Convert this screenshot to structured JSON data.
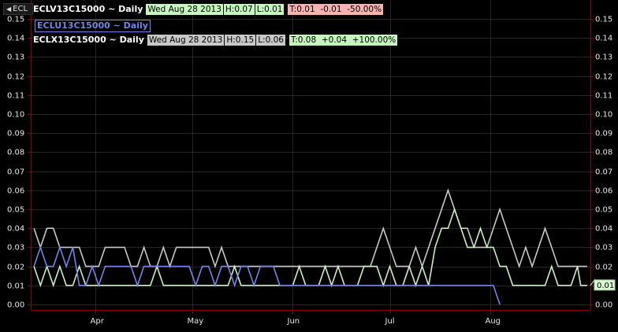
{
  "collapse_label": "ECL",
  "legend": [
    {
      "name": "ECLV13C15000 ~ Daily",
      "date": "Wed Aug 28 2013",
      "high": "H:0.07",
      "low": "L:0.01",
      "last": "T:0.01",
      "change": "-0.01",
      "pct": "-50.00%"
    },
    {
      "name": "ECLU13C15000 ~ Daily"
    },
    {
      "name": "ECLX13C15000 ~ Daily",
      "date": "Wed Aug 28 2013",
      "high": "H:0.15",
      "low": "L:0.06",
      "last": "T:0.08",
      "change": "+0.04",
      "pct": "+100.00%"
    }
  ],
  "colors": {
    "background": "#000000",
    "gridline": "#262626",
    "axis": "#8b0000",
    "series_white": "#c8c8c8",
    "series_green": "#c8f0c0",
    "series_blue": "#6f86e8",
    "tag_green": "#c6f5c0",
    "tag_red": "#f7b2b2",
    "tag_gray": "#c8c8c8"
  },
  "chart_data": {
    "type": "line",
    "ylim": [
      0,
      0.15
    ],
    "yticks": [
      "0.00",
      "0.01",
      "0.02",
      "0.03",
      "0.04",
      "0.05",
      "0.06",
      "0.07",
      "0.08",
      "0.09",
      "0.10",
      "0.11",
      "0.12",
      "0.13",
      "0.14",
      "0.15"
    ],
    "xlim": [
      "2013-03-12",
      "2013-09-01"
    ],
    "months": [
      {
        "label": "Apr",
        "date": "2013-04-01"
      },
      {
        "label": "May",
        "date": "2013-05-01"
      },
      {
        "label": "Jun",
        "date": "2013-06-01"
      },
      {
        "label": "Jul",
        "date": "2013-07-01"
      },
      {
        "label": "Aug",
        "date": "2013-08-01"
      }
    ],
    "last_value_label": "0.01",
    "series": [
      {
        "name": "ECLX13C15000 ~ Daily",
        "color": "#c8c8c8",
        "points": [
          [
            "2013-03-13",
            0.04
          ],
          [
            "2013-03-15",
            0.03
          ],
          [
            "2013-03-17",
            0.04
          ],
          [
            "2013-03-19",
            0.04
          ],
          [
            "2013-03-21",
            0.03
          ],
          [
            "2013-03-23",
            0.03
          ],
          [
            "2013-03-25",
            0.03
          ],
          [
            "2013-03-27",
            0.03
          ],
          [
            "2013-03-29",
            0.02
          ],
          [
            "2013-03-31",
            0.02
          ],
          [
            "2013-04-02",
            0.02
          ],
          [
            "2013-04-04",
            0.03
          ],
          [
            "2013-04-06",
            0.03
          ],
          [
            "2013-04-08",
            0.03
          ],
          [
            "2013-04-10",
            0.03
          ],
          [
            "2013-04-12",
            0.02
          ],
          [
            "2013-04-14",
            0.02
          ],
          [
            "2013-04-16",
            0.03
          ],
          [
            "2013-04-18",
            0.02
          ],
          [
            "2013-04-20",
            0.02
          ],
          [
            "2013-04-22",
            0.03
          ],
          [
            "2013-04-24",
            0.02
          ],
          [
            "2013-04-26",
            0.03
          ],
          [
            "2013-04-28",
            0.03
          ],
          [
            "2013-04-30",
            0.03
          ],
          [
            "2013-05-02",
            0.03
          ],
          [
            "2013-05-04",
            0.03
          ],
          [
            "2013-05-06",
            0.03
          ],
          [
            "2013-05-08",
            0.02
          ],
          [
            "2013-05-10",
            0.03
          ],
          [
            "2013-05-12",
            0.02
          ],
          [
            "2013-05-14",
            0.02
          ],
          [
            "2013-05-16",
            0.02
          ],
          [
            "2013-05-18",
            0.02
          ],
          [
            "2013-05-20",
            0.02
          ],
          [
            "2013-05-22",
            0.02
          ],
          [
            "2013-05-24",
            0.02
          ],
          [
            "2013-05-26",
            0.02
          ],
          [
            "2013-05-28",
            0.02
          ],
          [
            "2013-05-30",
            0.02
          ],
          [
            "2013-06-01",
            0.02
          ],
          [
            "2013-06-03",
            0.02
          ],
          [
            "2013-06-05",
            0.02
          ],
          [
            "2013-06-07",
            0.02
          ],
          [
            "2013-06-09",
            0.02
          ],
          [
            "2013-06-11",
            0.02
          ],
          [
            "2013-06-13",
            0.02
          ],
          [
            "2013-06-15",
            0.02
          ],
          [
            "2013-06-17",
            0.02
          ],
          [
            "2013-06-19",
            0.02
          ],
          [
            "2013-06-21",
            0.02
          ],
          [
            "2013-06-23",
            0.02
          ],
          [
            "2013-06-25",
            0.02
          ],
          [
            "2013-06-27",
            0.03
          ],
          [
            "2013-06-29",
            0.04
          ],
          [
            "2013-07-01",
            0.03
          ],
          [
            "2013-07-03",
            0.02
          ],
          [
            "2013-07-05",
            0.02
          ],
          [
            "2013-07-07",
            0.02
          ],
          [
            "2013-07-09",
            0.03
          ],
          [
            "2013-07-11",
            0.02
          ],
          [
            "2013-07-13",
            0.03
          ],
          [
            "2013-07-15",
            0.04
          ],
          [
            "2013-07-17",
            0.05
          ],
          [
            "2013-07-19",
            0.06
          ],
          [
            "2013-07-21",
            0.05
          ],
          [
            "2013-07-23",
            0.04
          ],
          [
            "2013-07-25",
            0.04
          ],
          [
            "2013-07-27",
            0.03
          ],
          [
            "2013-07-29",
            0.03
          ],
          [
            "2013-07-31",
            0.03
          ],
          [
            "2013-08-02",
            0.04
          ],
          [
            "2013-08-04",
            0.05
          ],
          [
            "2013-08-06",
            0.04
          ],
          [
            "2013-08-08",
            0.03
          ],
          [
            "2013-08-10",
            0.02
          ],
          [
            "2013-08-12",
            0.03
          ],
          [
            "2013-08-14",
            0.02
          ],
          [
            "2013-08-16",
            0.03
          ],
          [
            "2013-08-18",
            0.04
          ],
          [
            "2013-08-20",
            0.03
          ],
          [
            "2013-08-22",
            0.02
          ],
          [
            "2013-08-24",
            0.02
          ],
          [
            "2013-08-26",
            0.02
          ],
          [
            "2013-08-28",
            0.02
          ],
          [
            "2013-08-29",
            0.02
          ],
          [
            "2013-08-30",
            0.02
          ],
          [
            "2013-08-31",
            0.02
          ]
        ]
      },
      {
        "name": "ECLV13C15000 ~ Daily",
        "color": "#c8f0c0",
        "points": [
          [
            "2013-03-13",
            0.02
          ],
          [
            "2013-03-15",
            0.01
          ],
          [
            "2013-03-17",
            0.02
          ],
          [
            "2013-03-19",
            0.01
          ],
          [
            "2013-03-21",
            0.02
          ],
          [
            "2013-03-23",
            0.01
          ],
          [
            "2013-03-25",
            0.01
          ],
          [
            "2013-03-27",
            0.02
          ],
          [
            "2013-03-29",
            0.01
          ],
          [
            "2013-03-31",
            0.01
          ],
          [
            "2013-04-02",
            0.01
          ],
          [
            "2013-04-04",
            0.01
          ],
          [
            "2013-04-06",
            0.01
          ],
          [
            "2013-04-08",
            0.01
          ],
          [
            "2013-04-10",
            0.01
          ],
          [
            "2013-04-12",
            0.01
          ],
          [
            "2013-04-14",
            0.01
          ],
          [
            "2013-04-16",
            0.01
          ],
          [
            "2013-04-18",
            0.01
          ],
          [
            "2013-04-20",
            0.02
          ],
          [
            "2013-04-22",
            0.01
          ],
          [
            "2013-04-24",
            0.01
          ],
          [
            "2013-04-26",
            0.01
          ],
          [
            "2013-04-28",
            0.01
          ],
          [
            "2013-04-30",
            0.01
          ],
          [
            "2013-05-02",
            0.01
          ],
          [
            "2013-05-04",
            0.01
          ],
          [
            "2013-05-06",
            0.01
          ],
          [
            "2013-05-08",
            0.01
          ],
          [
            "2013-05-10",
            0.01
          ],
          [
            "2013-05-12",
            0.01
          ],
          [
            "2013-05-14",
            0.02
          ],
          [
            "2013-05-16",
            0.01
          ],
          [
            "2013-05-18",
            0.01
          ],
          [
            "2013-05-20",
            0.01
          ],
          [
            "2013-05-22",
            0.01
          ],
          [
            "2013-05-24",
            0.01
          ],
          [
            "2013-05-26",
            0.01
          ],
          [
            "2013-05-28",
            0.01
          ],
          [
            "2013-05-30",
            0.01
          ],
          [
            "2013-06-01",
            0.01
          ],
          [
            "2013-06-03",
            0.02
          ],
          [
            "2013-06-05",
            0.01
          ],
          [
            "2013-06-07",
            0.01
          ],
          [
            "2013-06-09",
            0.01
          ],
          [
            "2013-06-11",
            0.02
          ],
          [
            "2013-06-13",
            0.01
          ],
          [
            "2013-06-15",
            0.02
          ],
          [
            "2013-06-17",
            0.01
          ],
          [
            "2013-06-19",
            0.01
          ],
          [
            "2013-06-21",
            0.01
          ],
          [
            "2013-06-23",
            0.02
          ],
          [
            "2013-06-25",
            0.02
          ],
          [
            "2013-06-27",
            0.02
          ],
          [
            "2013-06-29",
            0.01
          ],
          [
            "2013-07-01",
            0.02
          ],
          [
            "2013-07-03",
            0.01
          ],
          [
            "2013-07-05",
            0.01
          ],
          [
            "2013-07-07",
            0.02
          ],
          [
            "2013-07-09",
            0.01
          ],
          [
            "2013-07-11",
            0.02
          ],
          [
            "2013-07-13",
            0.01
          ],
          [
            "2013-07-15",
            0.03
          ],
          [
            "2013-07-17",
            0.04
          ],
          [
            "2013-07-19",
            0.04
          ],
          [
            "2013-07-21",
            0.05
          ],
          [
            "2013-07-23",
            0.04
          ],
          [
            "2013-07-25",
            0.03
          ],
          [
            "2013-07-27",
            0.03
          ],
          [
            "2013-07-29",
            0.04
          ],
          [
            "2013-07-31",
            0.03
          ],
          [
            "2013-08-02",
            0.03
          ],
          [
            "2013-08-04",
            0.02
          ],
          [
            "2013-08-06",
            0.02
          ],
          [
            "2013-08-08",
            0.01
          ],
          [
            "2013-08-10",
            0.01
          ],
          [
            "2013-08-12",
            0.01
          ],
          [
            "2013-08-14",
            0.01
          ],
          [
            "2013-08-16",
            0.01
          ],
          [
            "2013-08-18",
            0.01
          ],
          [
            "2013-08-20",
            0.02
          ],
          [
            "2013-08-22",
            0.01
          ],
          [
            "2013-08-24",
            0.01
          ],
          [
            "2013-08-26",
            0.01
          ],
          [
            "2013-08-28",
            0.02
          ],
          [
            "2013-08-29",
            0.01
          ],
          [
            "2013-08-30",
            0.01
          ],
          [
            "2013-08-31",
            0.01
          ]
        ]
      },
      {
        "name": "ECLU13C15000 ~ Daily",
        "color": "#6f86e8",
        "points": [
          [
            "2013-03-13",
            0.02
          ],
          [
            "2013-03-15",
            0.03
          ],
          [
            "2013-03-17",
            0.02
          ],
          [
            "2013-03-19",
            0.02
          ],
          [
            "2013-03-21",
            0.03
          ],
          [
            "2013-03-23",
            0.02
          ],
          [
            "2013-03-25",
            0.03
          ],
          [
            "2013-03-27",
            0.01
          ],
          [
            "2013-03-29",
            0.01
          ],
          [
            "2013-03-31",
            0.02
          ],
          [
            "2013-04-02",
            0.01
          ],
          [
            "2013-04-04",
            0.02
          ],
          [
            "2013-04-06",
            0.02
          ],
          [
            "2013-04-08",
            0.02
          ],
          [
            "2013-04-10",
            0.02
          ],
          [
            "2013-04-12",
            0.02
          ],
          [
            "2013-04-14",
            0.01
          ],
          [
            "2013-04-16",
            0.02
          ],
          [
            "2013-04-18",
            0.02
          ],
          [
            "2013-04-20",
            0.02
          ],
          [
            "2013-04-22",
            0.02
          ],
          [
            "2013-04-24",
            0.02
          ],
          [
            "2013-04-26",
            0.02
          ],
          [
            "2013-04-28",
            0.02
          ],
          [
            "2013-04-30",
            0.02
          ],
          [
            "2013-05-02",
            0.01
          ],
          [
            "2013-05-04",
            0.02
          ],
          [
            "2013-05-06",
            0.02
          ],
          [
            "2013-05-08",
            0.01
          ],
          [
            "2013-05-10",
            0.02
          ],
          [
            "2013-05-12",
            0.02
          ],
          [
            "2013-05-14",
            0.01
          ],
          [
            "2013-05-16",
            0.02
          ],
          [
            "2013-05-18",
            0.02
          ],
          [
            "2013-05-20",
            0.01
          ],
          [
            "2013-05-22",
            0.02
          ],
          [
            "2013-05-24",
            0.02
          ],
          [
            "2013-05-26",
            0.02
          ],
          [
            "2013-05-28",
            0.01
          ],
          [
            "2013-05-30",
            0.01
          ],
          [
            "2013-06-01",
            0.01
          ],
          [
            "2013-06-03",
            0.01
          ],
          [
            "2013-06-05",
            0.01
          ],
          [
            "2013-06-07",
            0.01
          ],
          [
            "2013-06-09",
            0.01
          ],
          [
            "2013-06-11",
            0.01
          ],
          [
            "2013-06-13",
            0.01
          ],
          [
            "2013-06-15",
            0.01
          ],
          [
            "2013-06-17",
            0.01
          ],
          [
            "2013-06-19",
            0.01
          ],
          [
            "2013-06-21",
            0.01
          ],
          [
            "2013-06-23",
            0.01
          ],
          [
            "2013-06-25",
            0.01
          ],
          [
            "2013-06-27",
            0.01
          ],
          [
            "2013-06-29",
            0.01
          ],
          [
            "2013-07-01",
            0.01
          ],
          [
            "2013-07-03",
            0.01
          ],
          [
            "2013-07-05",
            0.01
          ],
          [
            "2013-07-07",
            0.01
          ],
          [
            "2013-07-09",
            0.01
          ],
          [
            "2013-07-11",
            0.01
          ],
          [
            "2013-07-13",
            0.01
          ],
          [
            "2013-07-15",
            0.01
          ],
          [
            "2013-07-17",
            0.01
          ],
          [
            "2013-07-19",
            0.01
          ],
          [
            "2013-07-21",
            0.01
          ],
          [
            "2013-07-23",
            0.01
          ],
          [
            "2013-07-25",
            0.01
          ],
          [
            "2013-07-27",
            0.01
          ],
          [
            "2013-07-29",
            0.01
          ],
          [
            "2013-07-31",
            0.01
          ],
          [
            "2013-08-02",
            0.01
          ],
          [
            "2013-08-04",
            0.0
          ]
        ]
      }
    ]
  }
}
